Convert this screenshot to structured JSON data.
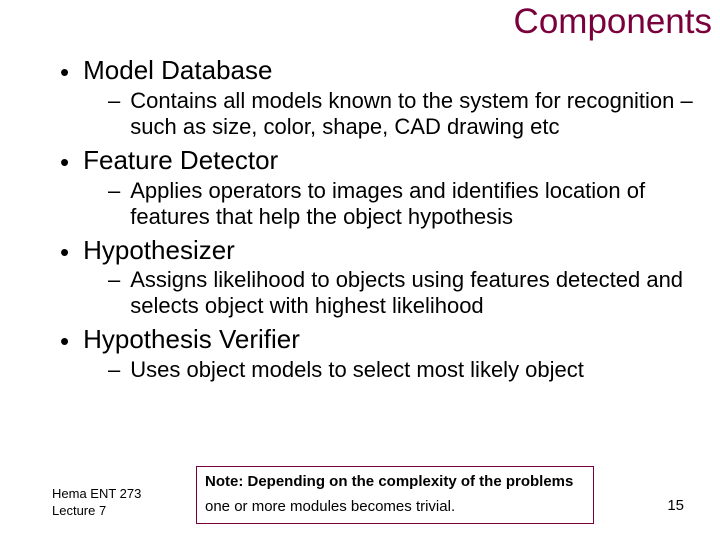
{
  "title": "Components",
  "bullets": [
    {
      "heading": "Model Database",
      "sub": "Contains all models known to the system for recognition –such as size, color, shape, CAD drawing etc"
    },
    {
      "heading": "Feature Detector",
      "sub": "Applies operators to images and identifies location of features that help the object hypothesis"
    },
    {
      "heading": "Hypothesizer",
      "sub": "Assigns likelihood  to objects using features detected and selects object with highest likelihood"
    },
    {
      "heading": "Hypothesis Verifier",
      "sub": "Uses object models to select most likely object"
    }
  ],
  "note": {
    "line1": "Note: Depending on the complexity of the problems",
    "line2": "one or more  modules becomes trivial."
  },
  "footer": {
    "author": "Hema   ENT 273",
    "lecture": "Lecture 7",
    "page": "15"
  }
}
